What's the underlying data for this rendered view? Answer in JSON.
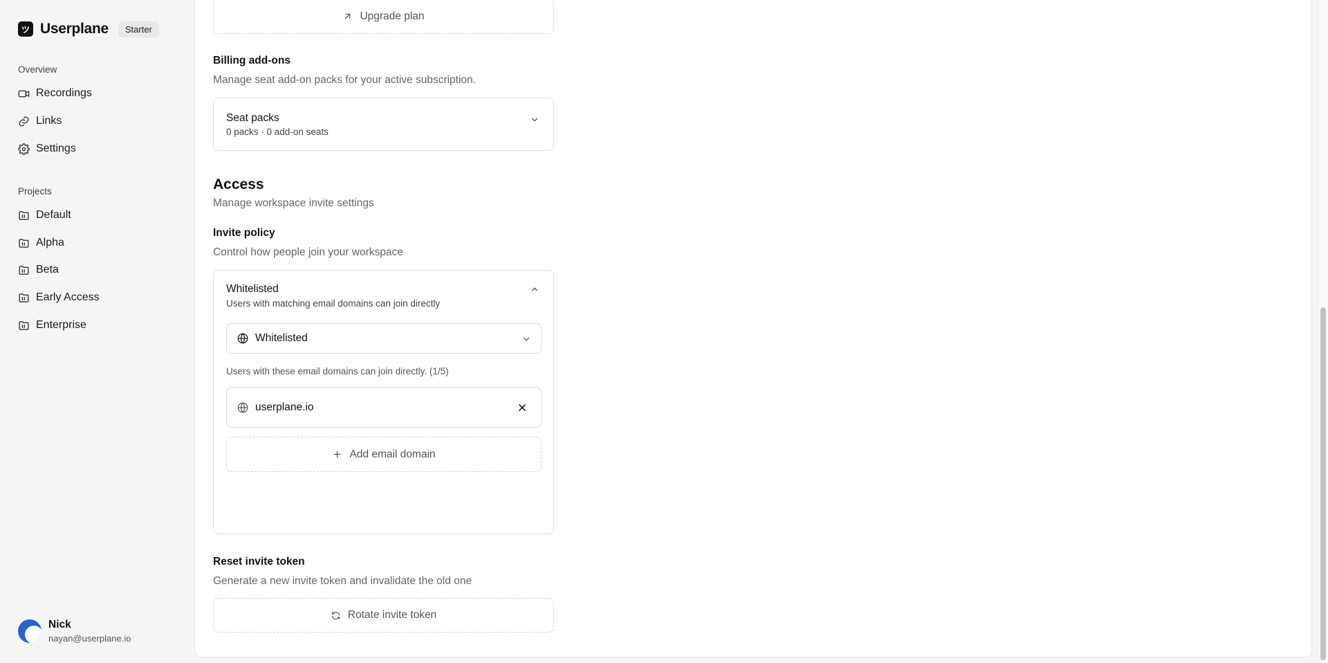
{
  "brand": {
    "name": "Userplane",
    "plan": "Starter",
    "logo_glyph": "ツ"
  },
  "nav": {
    "overview_label": "Overview",
    "items": [
      {
        "label": "Recordings",
        "icon": "video-icon"
      },
      {
        "label": "Links",
        "icon": "link-icon"
      },
      {
        "label": "Settings",
        "icon": "gear-icon"
      }
    ],
    "projects_label": "Projects",
    "projects": [
      {
        "label": "Default",
        "icon": "folder-icon"
      },
      {
        "label": "Alpha",
        "icon": "folder-icon"
      },
      {
        "label": "Beta",
        "icon": "folder-icon"
      },
      {
        "label": "Early Access",
        "icon": "folder-icon"
      },
      {
        "label": "Enterprise",
        "icon": "folder-icon"
      }
    ]
  },
  "user": {
    "name": "Nick",
    "email": "nayan@userplane.io"
  },
  "billing": {
    "upgrade_label": "Upgrade plan",
    "addons_title": "Billing add-ons",
    "addons_desc": "Manage seat add-on packs for your active subscription.",
    "seat_packs_title": "Seat packs",
    "seat_packs_sub": "0 packs · 0 add-on seats"
  },
  "access": {
    "title": "Access",
    "desc": "Manage workspace invite settings",
    "invite_policy_title": "Invite policy",
    "invite_policy_desc": "Control how people join your workspace",
    "policy_card_title": "Whitelisted",
    "policy_card_sub": "Users with matching email domains can join directly",
    "select_value": "Whitelisted",
    "domains_hint": "Users with these email domains can join directly. (1/5)",
    "domains": [
      "userplane.io"
    ],
    "add_domain_label": "Add email domain",
    "reset_title": "Reset invite token",
    "reset_desc": "Generate a new invite token and invalidate the old one",
    "rotate_label": "Rotate invite token"
  }
}
